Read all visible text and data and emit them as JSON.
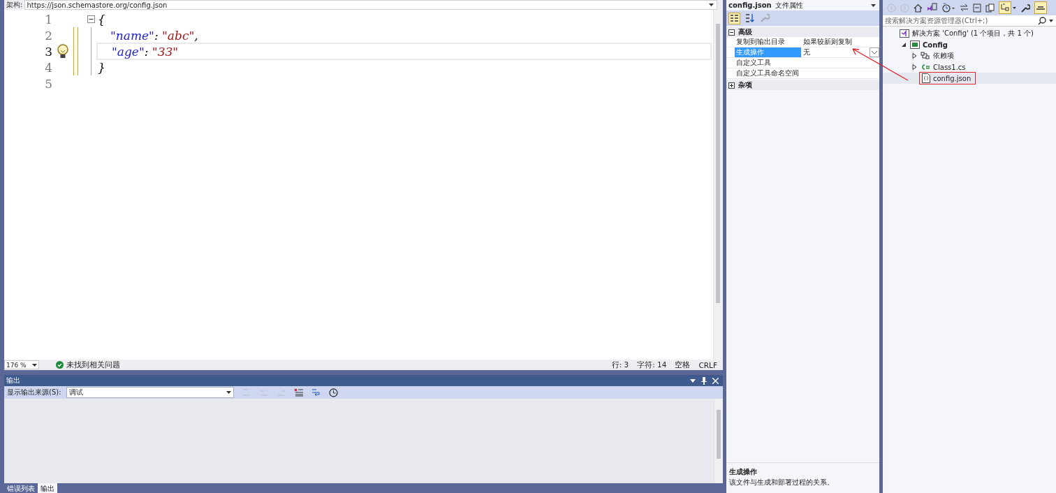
{
  "editor": {
    "schema_label": "架构:",
    "schema_url": "https://json.schemastore.org/config.json",
    "lines": [
      {
        "number": "1",
        "current": false,
        "changed": false,
        "fold": true,
        "tokens": [
          {
            "kind": "punct",
            "text": "{"
          }
        ]
      },
      {
        "number": "2",
        "current": false,
        "changed": true,
        "fold": false,
        "tokens": [
          {
            "kind": "key",
            "text": "\"name\""
          },
          {
            "kind": "punct",
            "text": ": "
          },
          {
            "kind": "string",
            "text": "\"abc\""
          },
          {
            "kind": "punct",
            "text": ","
          }
        ]
      },
      {
        "number": "3",
        "current": true,
        "changed": true,
        "fold": false,
        "tokens": [
          {
            "kind": "key",
            "text": "\"age\""
          },
          {
            "kind": "punct",
            "text": ": "
          },
          {
            "kind": "string",
            "text": "\"33\""
          }
        ]
      },
      {
        "number": "4",
        "current": false,
        "changed": true,
        "fold": false,
        "tokens": [
          {
            "kind": "punct",
            "text": "}"
          }
        ]
      },
      {
        "number": "5",
        "current": false,
        "changed": false,
        "fold": false
      }
    ],
    "status": {
      "zoom": "176 %",
      "issues": "未找到相关问题",
      "line": "行: 3",
      "char": "字符: 14",
      "indent": "空格",
      "eol": "CRLF"
    }
  },
  "output": {
    "title": "输出",
    "source_label": "显示输出来源(S):",
    "source": "调试"
  },
  "bottom_tabs": [
    {
      "label": "错误列表",
      "selected": false
    },
    {
      "label": "输出",
      "selected": true
    }
  ],
  "properties": {
    "title": "config.json",
    "subtitle": "文件属性",
    "categories": [
      {
        "name": "高级",
        "expanded": true,
        "rows": [
          {
            "name": "复制到输出目录",
            "value": "如果较新则复制",
            "selected": false
          },
          {
            "name": "生成操作",
            "value": "无",
            "selected": true
          },
          {
            "name": "自定义工具",
            "selected": false
          },
          {
            "name": "自定义工具命名空间",
            "selected": false
          }
        ]
      },
      {
        "name": "杂项",
        "expanded": false
      }
    ],
    "description": {
      "title": "生成操作",
      "text": "该文件与生成和部署过程的关系。"
    }
  },
  "solution_explorer": {
    "search": {
      "placeholder": "搜索解决方案资源管理器(Ctrl+;)"
    },
    "tree": [
      {
        "label": "解决方案 'Config' (1 个项目，共 1 个)",
        "kind": "solution",
        "annotated": false,
        "children": [
          {
            "label": "Config",
            "kind": "project",
            "expanded": true,
            "annotated": false,
            "children": [
              {
                "label": "依赖项",
                "kind": "deps",
                "expanded": false,
                "annotated": false
              },
              {
                "label": "Class1.cs",
                "kind": "cs",
                "expanded": false,
                "annotated": false
              },
              {
                "label": "config.json",
                "kind": "json",
                "annotated": true
              }
            ]
          }
        ]
      }
    ]
  }
}
